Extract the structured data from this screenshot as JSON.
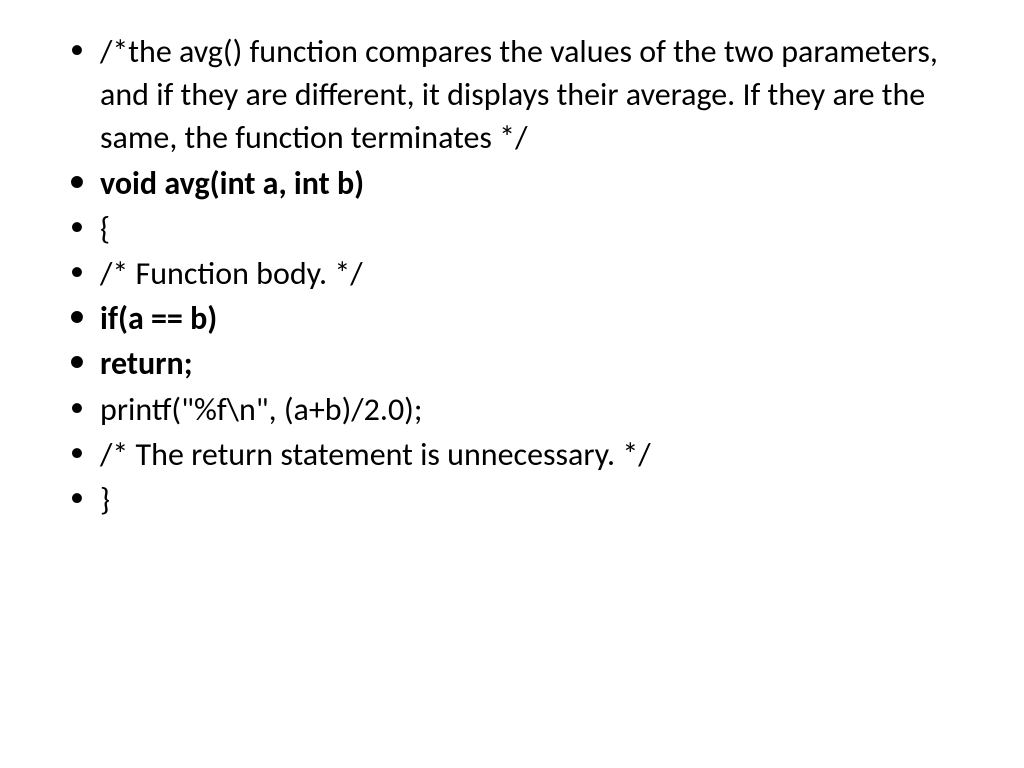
{
  "slide": {
    "bullets": [
      {
        "text": "/*the avg() function compares the values of the two parameters, and if they are different, it displays their average. If they are the same, the function terminates */",
        "bold": false
      },
      {
        "text": "void avg(int a, int b)",
        "bold": true
      },
      {
        "text": "{",
        "bold": false
      },
      {
        "text": "/* Function body. */",
        "bold": false
      },
      {
        "text": "if(a == b)",
        "bold": true
      },
      {
        "text": "return;",
        "bold": true
      },
      {
        "text": "printf(\"%f\\n\", (a+b)/2.0);",
        "bold": false
      },
      {
        "text": "/* The return statement is unnecessary. */",
        "bold": false
      },
      {
        "text": "}",
        "bold": false
      }
    ]
  }
}
